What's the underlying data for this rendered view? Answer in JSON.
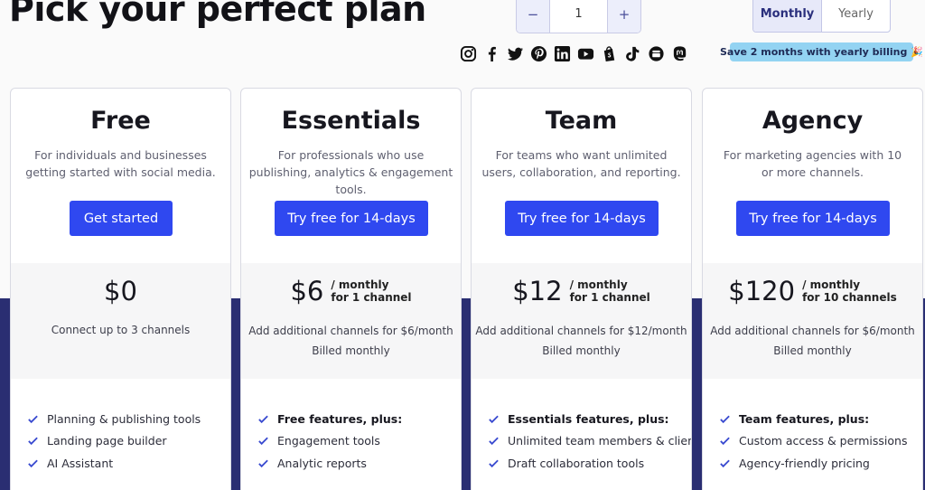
{
  "headline": "Pick your perfect plan",
  "stepper": {
    "minus": "−",
    "value": "1",
    "plus": "+"
  },
  "billing": {
    "monthly": "Monthly",
    "yearly": "Yearly"
  },
  "save_badge": {
    "text": "Save 2 months with yearly billing",
    "emoji": "🎉"
  },
  "socials": [
    "instagram-icon",
    "facebook-icon",
    "twitter-icon",
    "pinterest-icon",
    "linkedin-icon",
    "youtube-icon",
    "shopify-icon",
    "tiktok-icon",
    "google-business-icon",
    "mastodon-icon"
  ],
  "colors": {
    "accent": "#2f48f0",
    "navy": "#2a2e72",
    "badge": "#93d3f2"
  },
  "plans": [
    {
      "name": "Free",
      "description": "For individuals and businesses getting started with social media.",
      "cta": "Get started",
      "price": "$0",
      "price_period": "",
      "price_scope": "",
      "note1": "Connect up to 3 channels",
      "note2": "",
      "features": [
        "Planning & publishing tools",
        "Landing page builder",
        "AI Assistant"
      ]
    },
    {
      "name": "Essentials",
      "description": "For professionals who use publishing, analytics & engagement tools.",
      "cta": "Try free for 14-days",
      "price": "$6",
      "price_period": "/ monthly",
      "price_scope": "for 1 channel",
      "note1": "Add additional channels for $6/month",
      "note2": "Billed monthly",
      "features": [
        "Free features, plus:",
        "Engagement tools",
        "Analytic reports"
      ]
    },
    {
      "name": "Team",
      "description": "For teams who want unlimited users, collaboration, and reporting.",
      "cta": "Try free for 14-days",
      "price": "$12",
      "price_period": "/ monthly",
      "price_scope": "for 1 channel",
      "note1": "Add additional channels for $12/month",
      "note2": "Billed monthly",
      "features": [
        "Essentials features, plus:",
        "Unlimited team members & clients",
        "Draft collaboration tools"
      ]
    },
    {
      "name": "Agency",
      "description": "For marketing agencies with 10 or more channels.",
      "cta": "Try free for 14-days",
      "price": "$120",
      "price_period": "/ monthly",
      "price_scope": "for 10 channels",
      "note1": "Add additional channels for $6/month",
      "note2": "Billed monthly",
      "features": [
        "Team features, plus:",
        "Custom access & permissions",
        "Agency-friendly pricing"
      ]
    }
  ]
}
